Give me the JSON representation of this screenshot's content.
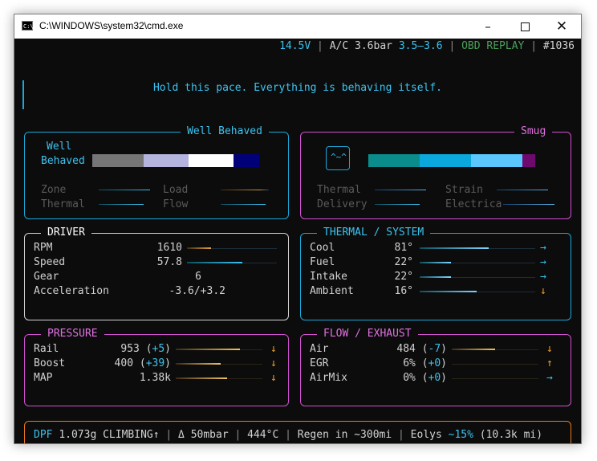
{
  "window": {
    "title": "C:\\WINDOWS\\system32\\cmd.exe",
    "icon": "cmd-icon",
    "minimize": "minimize-icon",
    "maximize": "maximize-icon",
    "close": "close-icon"
  },
  "status": {
    "voltage": "14.5V",
    "sep": "|",
    "ac_label": "A/C",
    "ac_pressure": "3.6bar",
    "ac_range": "3.5–3.6",
    "mode": "OBD REPLAY",
    "frame": "#1036"
  },
  "message": "Hold this pace. Everything is behaving itself.",
  "left_mood": {
    "title": "Well Behaved",
    "label_1": "Well",
    "label_2": "Behaved",
    "meters": [
      "Zone",
      "Load",
      "Thermal",
      "Flow"
    ],
    "colors": [
      "#767676",
      "#b4b4de",
      "#ffffff",
      "#000078"
    ]
  },
  "right_mood": {
    "title": "Smug",
    "face": "^~^",
    "meters": [
      "Thermal",
      "Strain",
      "Delivery",
      "Electrica"
    ],
    "colors": [
      "#0a8c8c",
      "#0aa8dc",
      "#5ac8ff",
      "#6e0a6e"
    ]
  },
  "driver": {
    "title": "DRIVER",
    "rows": [
      {
        "label": "RPM",
        "value": "1610",
        "level": 0.27
      },
      {
        "label": "Speed",
        "value": "57.8",
        "level": 0.62
      },
      {
        "label": "Gear",
        "value": "6"
      },
      {
        "label": "Acceleration",
        "value": "-3.6/+3.2"
      }
    ]
  },
  "thermal": {
    "title": "THERMAL / SYSTEM",
    "rows": [
      {
        "label": "Cool",
        "value": "81°",
        "arrow": "→",
        "level": 0.6
      },
      {
        "label": "Fuel",
        "value": "22°",
        "arrow": "→",
        "level": 0.27
      },
      {
        "label": "Intake",
        "value": "22°",
        "arrow": "→",
        "level": 0.27
      },
      {
        "label": "Ambient",
        "value": "16°",
        "arrow": "↓",
        "level": 0.49
      }
    ]
  },
  "pressure": {
    "title": "PRESSURE",
    "rows": [
      {
        "label": "Rail",
        "value": "953",
        "delta": "+5",
        "arrow": "↓",
        "level": 0.74
      },
      {
        "label": "Boost",
        "value": "400",
        "delta": "+39",
        "arrow": "↓",
        "level": 0.52
      },
      {
        "label": "MAP",
        "value": "1.38k",
        "delta": "",
        "arrow": "↓",
        "level": 0.59
      }
    ]
  },
  "flow": {
    "title": "FLOW / EXHAUST",
    "rows": [
      {
        "label": "Air",
        "value": "484",
        "delta": "-7",
        "arrow": "↓",
        "level": 0.5
      },
      {
        "label": "EGR",
        "value": "6%",
        "delta": "+0",
        "arrow": "↑",
        "level": 0.0
      },
      {
        "label": "AirMix",
        "value": "0%",
        "delta": "+0",
        "arrow": "→",
        "level": 0.0
      }
    ]
  },
  "footer": {
    "dpf_label": "DPF",
    "dpf_value": "1.073g",
    "dpf_state": "CLIMBING↑",
    "sep": "|",
    "delta": "Δ 50mbar",
    "temp": "444°C",
    "regen": "Regen in ~300mi",
    "eolys_label": "Eolys",
    "eolys_pct": "~15%",
    "eolys_range": "(10.3k mi)"
  }
}
